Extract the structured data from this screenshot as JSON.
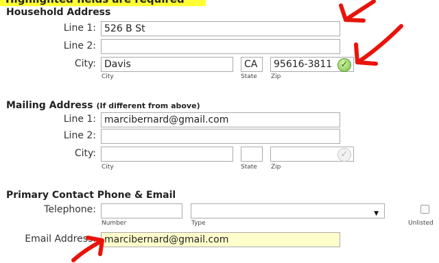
{
  "banner": {
    "text": "Highlighted fields are required"
  },
  "household": {
    "title": "Household Address",
    "line1_label": "Line 1:",
    "line1_value": "526 B St",
    "line2_label": "Line 2:",
    "line2_value": "",
    "city_label": "City:",
    "city_value": "Davis",
    "state_value": "CA",
    "zip_value": "95616-3811",
    "city_sub": "City",
    "state_sub": "State",
    "zip_sub": "Zip",
    "zip_check_icon": "check-circle-green"
  },
  "mailing": {
    "title": "Mailing Address",
    "note": "(If different from above)",
    "line1_label": "Line 1:",
    "line1_value": "marcibernard@gmail.com",
    "line2_label": "Line 2:",
    "line2_value": "",
    "city_label": "City:",
    "city_value": "",
    "state_value": "",
    "zip_value": "",
    "city_sub": "City",
    "state_sub": "State",
    "zip_sub": "Zip",
    "zip_check_icon": "check-circle-grey"
  },
  "contact": {
    "title": "Primary Contact Phone & Email",
    "telephone_label": "Telephone:",
    "number_value": "",
    "type_value": "",
    "number_sub": "Number",
    "type_sub": "Type",
    "unlisted_label": "Unlisted",
    "unlisted_checked": false,
    "email_label": "Email Address:",
    "email_value": "marcibernard@gmail.com"
  },
  "annotations": {
    "arrow_color": "#e8140c"
  }
}
